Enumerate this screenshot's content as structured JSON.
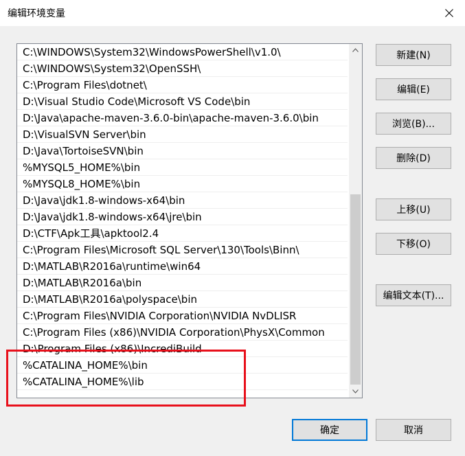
{
  "window": {
    "title": "编辑环境变量"
  },
  "icons": {
    "close": "close-icon",
    "scroll_up": "chevron-up-icon",
    "scroll_down": "chevron-down-icon"
  },
  "paths": [
    "C:\\WINDOWS\\System32\\WindowsPowerShell\\v1.0\\",
    "C:\\WINDOWS\\System32\\OpenSSH\\",
    "C:\\Program Files\\dotnet\\",
    "D:\\Visual Studio Code\\Microsoft VS Code\\bin",
    "D:\\Java\\apache-maven-3.6.0-bin\\apache-maven-3.6.0\\bin",
    "D:\\VisualSVN Server\\bin",
    "D:\\Java\\TortoiseSVN\\bin",
    "%MYSQL5_HOME%\\bin",
    "%MYSQL8_HOME%\\bin",
    "D:\\Java\\jdk1.8-windows-x64\\bin",
    "D:\\Java\\jdk1.8-windows-x64\\jre\\bin",
    "D:\\CTF\\Apk工具\\apktool2.4",
    "C:\\Program Files\\Microsoft SQL Server\\130\\Tools\\Binn\\",
    "D:\\MATLAB\\R2016a\\runtime\\win64",
    "D:\\MATLAB\\R2016a\\bin",
    "D:\\MATLAB\\R2016a\\polyspace\\bin",
    "C:\\Program Files\\NVIDIA Corporation\\NVIDIA NvDLISR",
    "C:\\Program Files (x86)\\NVIDIA Corporation\\PhysX\\Common",
    "D:\\Program Files (x86)\\IncrediBuild",
    "%CATALINA_HOME%\\bin",
    "%CATALINA_HOME%\\lib"
  ],
  "buttons": {
    "new": "新建(N)",
    "edit": "编辑(E)",
    "browse": "浏览(B)...",
    "delete": "删除(D)",
    "move_up": "上移(U)",
    "move_down": "下移(O)",
    "edit_text": "编辑文本(T)...",
    "ok": "确定",
    "cancel": "取消"
  },
  "colors": {
    "highlight_box": "#e8101b",
    "primary_button_border": "#0078d7"
  }
}
